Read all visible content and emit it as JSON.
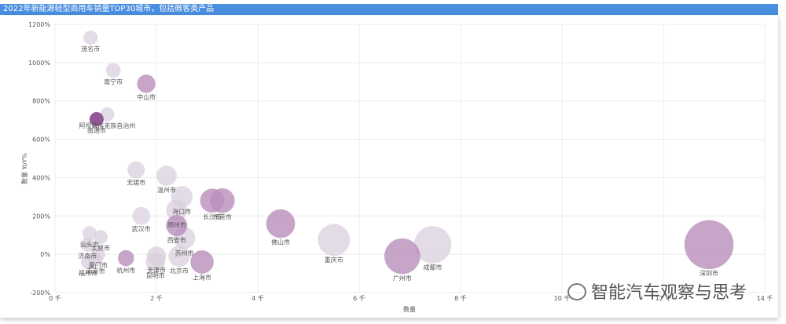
{
  "title": "2022年新能源轻型商用车销量TOP30城市，包括微客类产品",
  "watermark": "智能汽车观察与思考",
  "chart_data": {
    "type": "scatter",
    "title": "2022年新能源轻型商用车销量TOP30城市，包括微客类产品",
    "xlabel": "数量",
    "ylabel": "数量 YoY%",
    "xlim": [
      0,
      14000
    ],
    "ylim": [
      -200,
      1200
    ],
    "x_ticks": [
      0,
      2000,
      4000,
      6000,
      8000,
      10000,
      12000,
      14000
    ],
    "x_tick_labels": [
      "0 千",
      "2 千",
      "4 千",
      "6 千",
      "8 千",
      "10 千",
      "12 千",
      "14 千"
    ],
    "y_ticks": [
      -200,
      0,
      200,
      400,
      600,
      800,
      1000,
      1200
    ],
    "y_tick_labels": [
      "-200%",
      "0%",
      "200%",
      "400%",
      "600%",
      "800%",
      "1000%",
      "1200%"
    ],
    "grid": true,
    "size_encoding": "数量",
    "colors": {
      "light": "#d9cfdc",
      "mid": "#b98ebc",
      "dark": "#8e4f94"
    },
    "points": [
      {
        "label": "茂名市",
        "x": 700,
        "y": 1130,
        "color": "light"
      },
      {
        "label": "南宁市",
        "x": 1150,
        "y": 960,
        "color": "light"
      },
      {
        "label": "中山市",
        "x": 1800,
        "y": 890,
        "color": "mid"
      },
      {
        "label": "阿坝藏族羌族自治州",
        "x": 1030,
        "y": 730,
        "color": "light"
      },
      {
        "label": "南通市",
        "x": 820,
        "y": 705,
        "color": "dark"
      },
      {
        "label": "无锡市",
        "x": 1600,
        "y": 440,
        "color": "light"
      },
      {
        "label": "温州市",
        "x": 2200,
        "y": 410,
        "color": "light"
      },
      {
        "label": "长沙市",
        "x": 3100,
        "y": 280,
        "color": "mid"
      },
      {
        "label": "东莞市",
        "x": 3300,
        "y": 280,
        "color": "mid"
      },
      {
        "label": "海口市",
        "x": 2500,
        "y": 300,
        "color": "light"
      },
      {
        "label": "郑州市",
        "x": 2400,
        "y": 230,
        "color": "light"
      },
      {
        "label": "武汉市",
        "x": 1700,
        "y": 200,
        "color": "light"
      },
      {
        "label": "西安市",
        "x": 2400,
        "y": 150,
        "color": "mid"
      },
      {
        "label": "苏州市",
        "x": 2550,
        "y": 85,
        "color": "light"
      },
      {
        "label": "佛山市",
        "x": 4450,
        "y": 160,
        "color": "mid"
      },
      {
        "label": "重庆市",
        "x": 5500,
        "y": 75,
        "color": "light"
      },
      {
        "label": "广州市",
        "x": 6850,
        "y": -10,
        "color": "mid"
      },
      {
        "label": "成都市",
        "x": 7450,
        "y": 50,
        "color": "light"
      },
      {
        "label": "深圳市",
        "x": 12900,
        "y": 50,
        "color": "mid"
      },
      {
        "label": "汕头市",
        "x": 680,
        "y": 110,
        "color": "light"
      },
      {
        "label": "太原市",
        "x": 900,
        "y": 90,
        "color": "light"
      },
      {
        "label": "济南市",
        "x": 640,
        "y": 50,
        "color": "light"
      },
      {
        "label": "厦门市",
        "x": 850,
        "y": 0,
        "color": "light"
      },
      {
        "label": "南京市",
        "x": 800,
        "y": -30,
        "color": "light"
      },
      {
        "label": "福州市",
        "x": 650,
        "y": -40,
        "color": "light"
      },
      {
        "label": "杭州市",
        "x": 1400,
        "y": -20,
        "color": "mid"
      },
      {
        "label": "天津市",
        "x": 2000,
        "y": -10,
        "color": "light"
      },
      {
        "label": "昆明市",
        "x": 1980,
        "y": -40,
        "color": "light"
      },
      {
        "label": "北京市",
        "x": 2450,
        "y": -10,
        "color": "light"
      },
      {
        "label": "上海市",
        "x": 2900,
        "y": -40,
        "color": "mid"
      }
    ]
  }
}
